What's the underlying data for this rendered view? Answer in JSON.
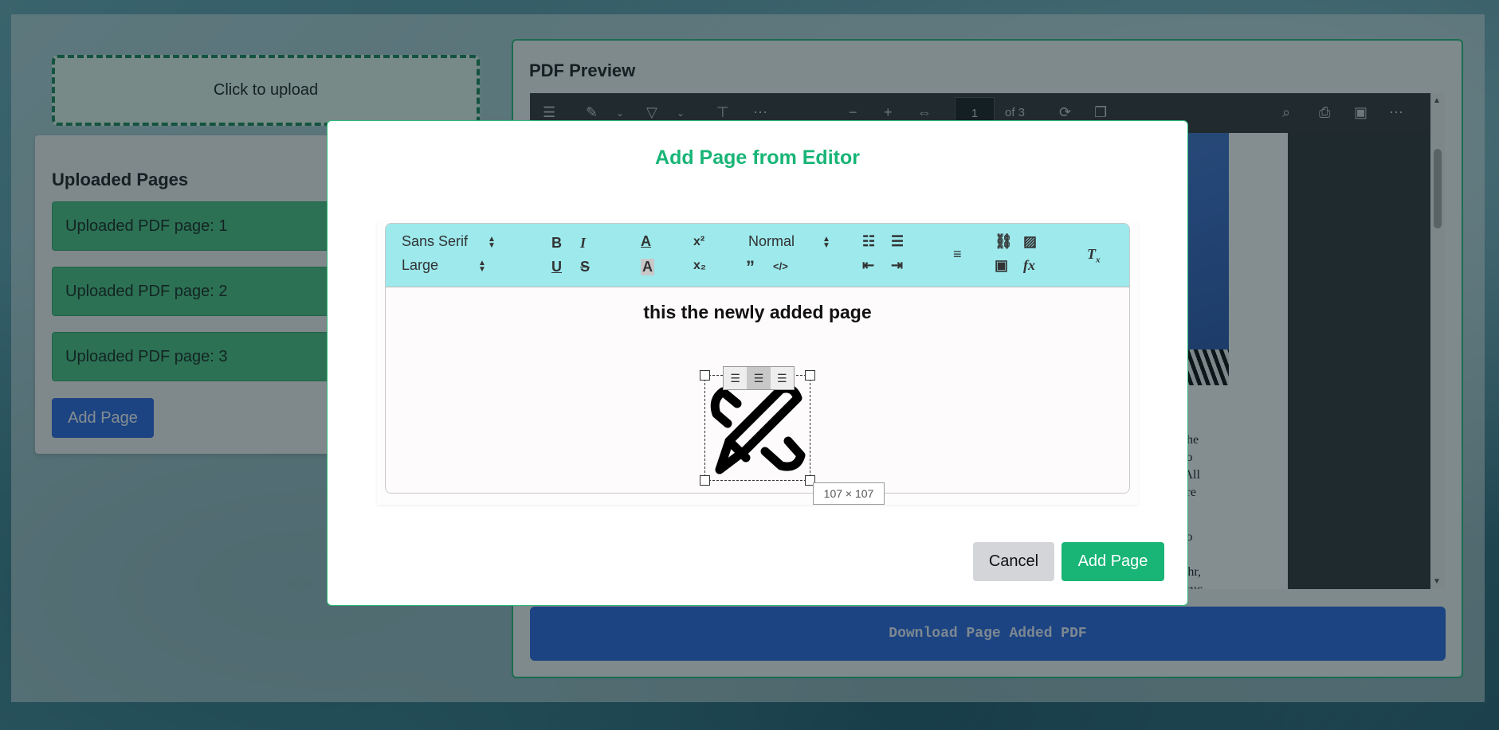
{
  "upload": {
    "label": "Click to upload"
  },
  "uploaded": {
    "title": "Uploaded Pages",
    "items": [
      {
        "label": "Uploaded PDF page: 1"
      },
      {
        "label": "Uploaded PDF page: 2"
      },
      {
        "label": "Uploaded PDF page: 3"
      }
    ],
    "add_button": "Add Page"
  },
  "preview": {
    "title": "PDF Preview",
    "current_page": "1",
    "page_of": "of 3",
    "doc_text_lines": [
      "al, the",
      "ed to",
      "es. All",
      "ss are",
      "ke to",
      "he",
      "n Jahr,",
      "d Druc"
    ],
    "download_button": "Download Page Added PDF"
  },
  "modal": {
    "title": "Add Page from Editor",
    "toolbar": {
      "font": "Sans Serif",
      "size": "Large",
      "header": "Normal"
    },
    "content_text": "this the newly added page",
    "image_size": "107 × 107",
    "cancel_button": "Cancel",
    "add_button": "Add Page"
  }
}
